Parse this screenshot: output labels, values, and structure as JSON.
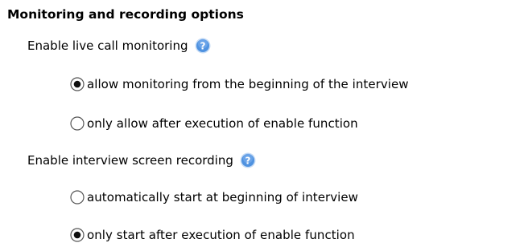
{
  "section": {
    "title": "Monitoring and recording options"
  },
  "monitoring": {
    "label": "Enable live call monitoring",
    "help_icon": "help-question-icon",
    "options": [
      {
        "label": "allow monitoring from the beginning of the interview",
        "selected": true
      },
      {
        "label": "only allow after execution of enable function",
        "selected": false
      }
    ]
  },
  "recording": {
    "label": "Enable interview screen recording",
    "help_icon": "help-question-icon",
    "options": [
      {
        "label": "automatically start at beginning of interview",
        "selected": false
      },
      {
        "label": "only start after execution of enable function",
        "selected": true
      }
    ]
  },
  "colors": {
    "help_icon_fill": "#4f92e0",
    "help_icon_ring": "#c7dcf5",
    "radio_border": "#555555",
    "radio_dot": "#111111"
  }
}
